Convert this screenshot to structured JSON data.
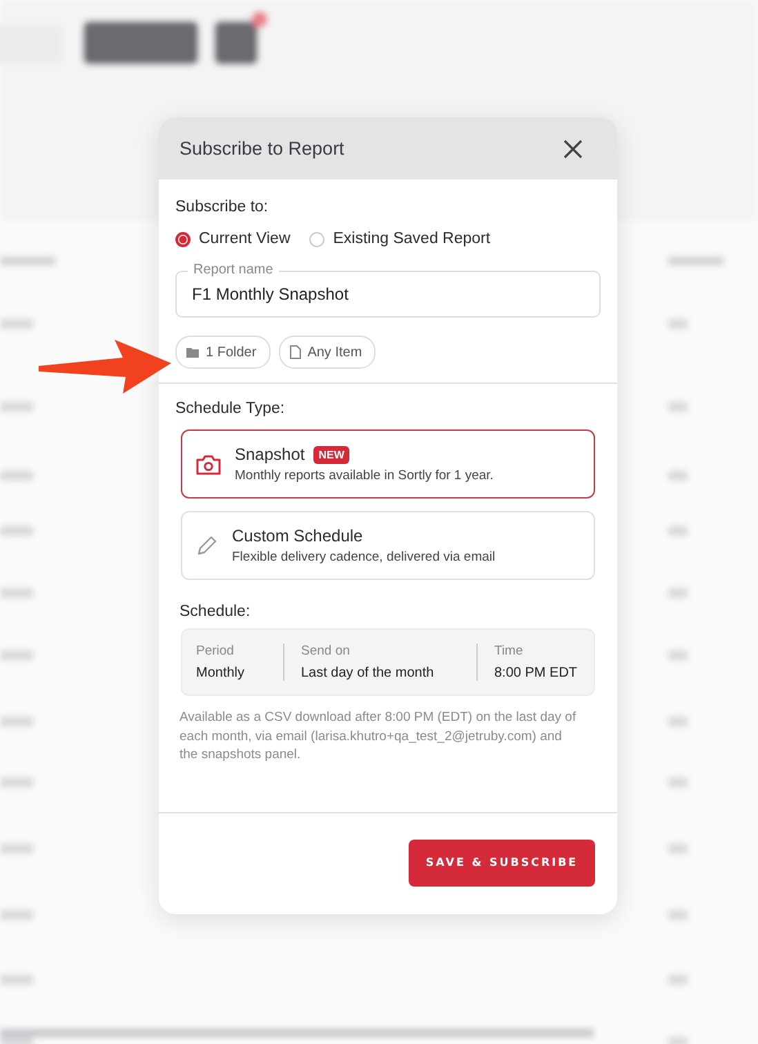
{
  "dialog": {
    "title": "Subscribe to Report",
    "subscribe_label": "Subscribe to:",
    "radios": [
      {
        "label": "Current View",
        "selected": true
      },
      {
        "label": "Existing Saved Report",
        "selected": false
      }
    ],
    "report_name": {
      "label": "Report name",
      "value": "F1 Monthly Snapshot"
    },
    "filters": [
      {
        "kind": "folder",
        "label": "1 Folder"
      },
      {
        "kind": "item",
        "label": "Any Item"
      }
    ],
    "schedule_type_label": "Schedule Type:",
    "schedule_types": [
      {
        "kind": "snapshot",
        "title": "Snapshot",
        "badge": "NEW",
        "description": "Monthly reports available in Sortly for 1 year.",
        "selected": true
      },
      {
        "kind": "custom",
        "title": "Custom Schedule",
        "description": "Flexible delivery cadence, delivered via email",
        "selected": false
      }
    ],
    "schedule_label": "Schedule:",
    "schedule_fields": [
      {
        "label": "Period",
        "value": "Monthly"
      },
      {
        "label": "Send on",
        "value": "Last day of the month"
      },
      {
        "label": "Time",
        "value": "8:00 PM EDT"
      }
    ],
    "note": "Available as a CSV download after 8:00 PM (EDT) on the last day of each month, via email (larisa.khutro+qa_test_2@jetruby.com) and the snapshots panel.",
    "primary_button": "SAVE & SUBSCRIBE"
  }
}
